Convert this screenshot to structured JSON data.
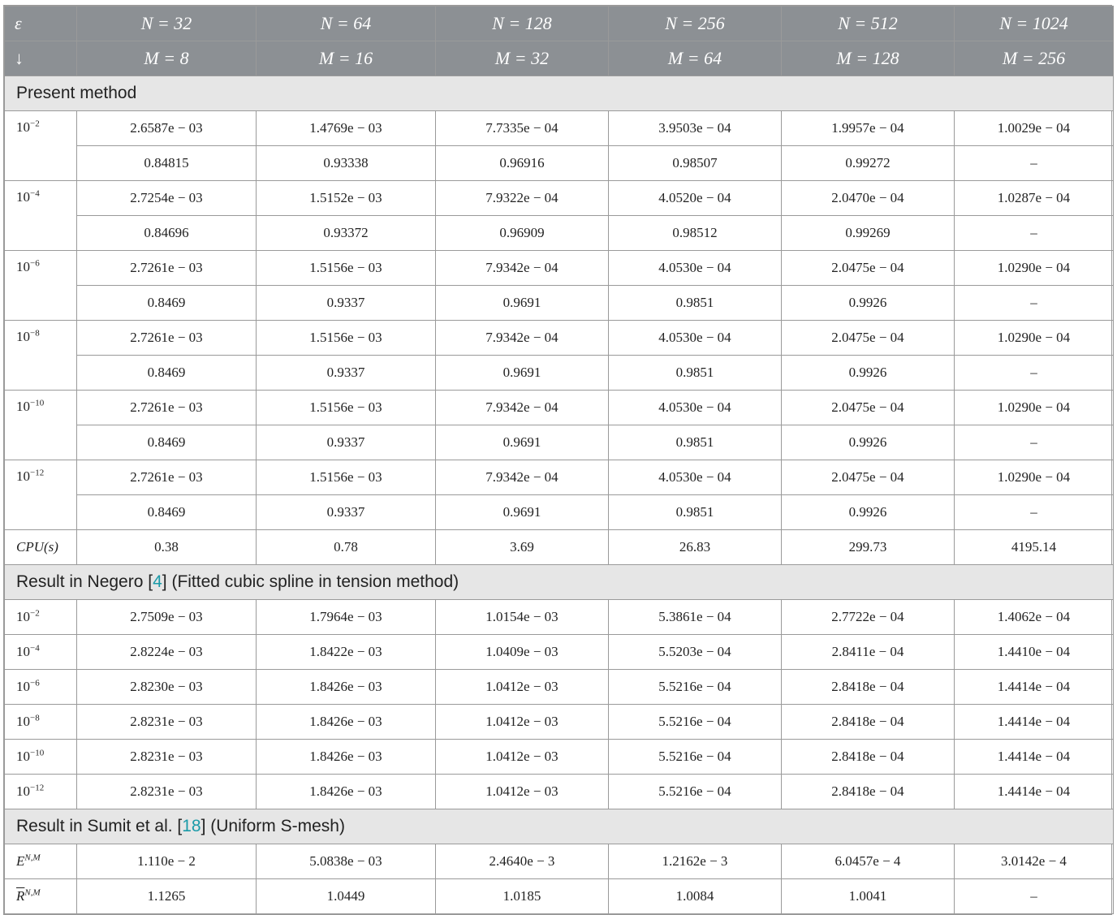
{
  "header": {
    "row1": [
      "ε",
      "N = 32",
      "N = 64",
      "N = 128",
      "N = 256",
      "N = 512",
      "N = 1024"
    ],
    "row2": [
      "↓",
      "M = 8",
      "M = 16",
      "M = 32",
      "M = 64",
      "M = 128",
      "M = 256"
    ]
  },
  "section1": {
    "title": "Present method",
    "groups": [
      {
        "eps_base": "10",
        "eps_exp": "−2",
        "errors": [
          "2.6587e − 03",
          "1.4769e − 03",
          "7.7335e − 04",
          "3.9503e − 04",
          "1.9957e − 04",
          "1.0029e − 04"
        ],
        "rates": [
          "0.84815",
          "0.93338",
          "0.96916",
          "0.98507",
          "0.99272",
          "–"
        ]
      },
      {
        "eps_base": "10",
        "eps_exp": "−4",
        "errors": [
          "2.7254e − 03",
          "1.5152e − 03",
          "7.9322e − 04",
          "4.0520e − 04",
          "2.0470e − 04",
          "1.0287e − 04"
        ],
        "rates": [
          "0.84696",
          "0.93372",
          "0.96909",
          "0.98512",
          "0.99269",
          "–"
        ]
      },
      {
        "eps_base": "10",
        "eps_exp": "−6",
        "errors": [
          "2.7261e − 03",
          "1.5156e − 03",
          "7.9342e − 04",
          "4.0530e − 04",
          "2.0475e − 04",
          "1.0290e − 04"
        ],
        "rates": [
          "0.8469",
          "0.9337",
          "0.9691",
          "0.9851",
          "0.9926",
          "–"
        ]
      },
      {
        "eps_base": "10",
        "eps_exp": "−8",
        "errors": [
          "2.7261e − 03",
          "1.5156e − 03",
          "7.9342e − 04",
          "4.0530e − 04",
          "2.0475e − 04",
          "1.0290e − 04"
        ],
        "rates": [
          "0.8469",
          "0.9337",
          "0.9691",
          "0.9851",
          "0.9926",
          "–"
        ]
      },
      {
        "eps_base": "10",
        "eps_exp": "−10",
        "errors": [
          "2.7261e − 03",
          "1.5156e − 03",
          "7.9342e − 04",
          "4.0530e − 04",
          "2.0475e − 04",
          "1.0290e − 04"
        ],
        "rates": [
          "0.8469",
          "0.9337",
          "0.9691",
          "0.9851",
          "0.9926",
          "–"
        ]
      },
      {
        "eps_base": "10",
        "eps_exp": "−12",
        "errors": [
          "2.7261e − 03",
          "1.5156e − 03",
          "7.9342e − 04",
          "4.0530e − 04",
          "2.0475e − 04",
          "1.0290e − 04"
        ],
        "rates": [
          "0.8469",
          "0.9337",
          "0.9691",
          "0.9851",
          "0.9926",
          "–"
        ]
      }
    ],
    "cpu_label": "CPU(s)",
    "cpu": [
      "0.38",
      "0.78",
      "3.69",
      "26.83",
      "299.73",
      "4195.14"
    ]
  },
  "section2": {
    "title_pre": "Result in Negero [",
    "title_ref": "4",
    "title_post": "] (Fitted cubic spline in tension method)",
    "rows": [
      {
        "eps_base": "10",
        "eps_exp": "−2",
        "values": [
          "2.7509e − 03",
          "1.7964e − 03",
          "1.0154e − 03",
          "5.3861e − 04",
          "2.7722e − 04",
          "1.4062e − 04"
        ]
      },
      {
        "eps_base": "10",
        "eps_exp": "−4",
        "values": [
          "2.8224e − 03",
          "1.8422e − 03",
          "1.0409e − 03",
          "5.5203e − 04",
          "2.8411e − 04",
          "1.4410e − 04"
        ]
      },
      {
        "eps_base": "10",
        "eps_exp": "−6",
        "values": [
          "2.8230e − 03",
          "1.8426e − 03",
          "1.0412e − 03",
          "5.5216e − 04",
          "2.8418e − 04",
          "1.4414e − 04"
        ]
      },
      {
        "eps_base": "10",
        "eps_exp": "−8",
        "values": [
          "2.8231e − 03",
          "1.8426e − 03",
          "1.0412e − 03",
          "5.5216e − 04",
          "2.8418e − 04",
          "1.4414e − 04"
        ]
      },
      {
        "eps_base": "10",
        "eps_exp": "−10",
        "values": [
          "2.8231e − 03",
          "1.8426e − 03",
          "1.0412e − 03",
          "5.5216e − 04",
          "2.8418e − 04",
          "1.4414e − 04"
        ]
      },
      {
        "eps_base": "10",
        "eps_exp": "−12",
        "values": [
          "2.8231e − 03",
          "1.8426e − 03",
          "1.0412e − 03",
          "5.5216e − 04",
          "2.8418e − 04",
          "1.4414e − 04"
        ]
      }
    ]
  },
  "section3": {
    "title_pre": "Result in Sumit et al. [",
    "title_ref": "18",
    "title_post": "] (Uniform S-mesh)",
    "rows": [
      {
        "label_base": "E",
        "label_sup": "N,M",
        "overbar": false,
        "values": [
          "1.110e − 2",
          "5.0838e − 03",
          "2.4640e − 3",
          "1.2162e − 3",
          "6.0457e − 4",
          "3.0142e − 4"
        ]
      },
      {
        "label_base": "R",
        "label_sup": "N,M",
        "overbar": true,
        "values": [
          "1.1265",
          "1.0449",
          "1.0185",
          "1.0084",
          "1.0041",
          "–"
        ]
      }
    ]
  }
}
